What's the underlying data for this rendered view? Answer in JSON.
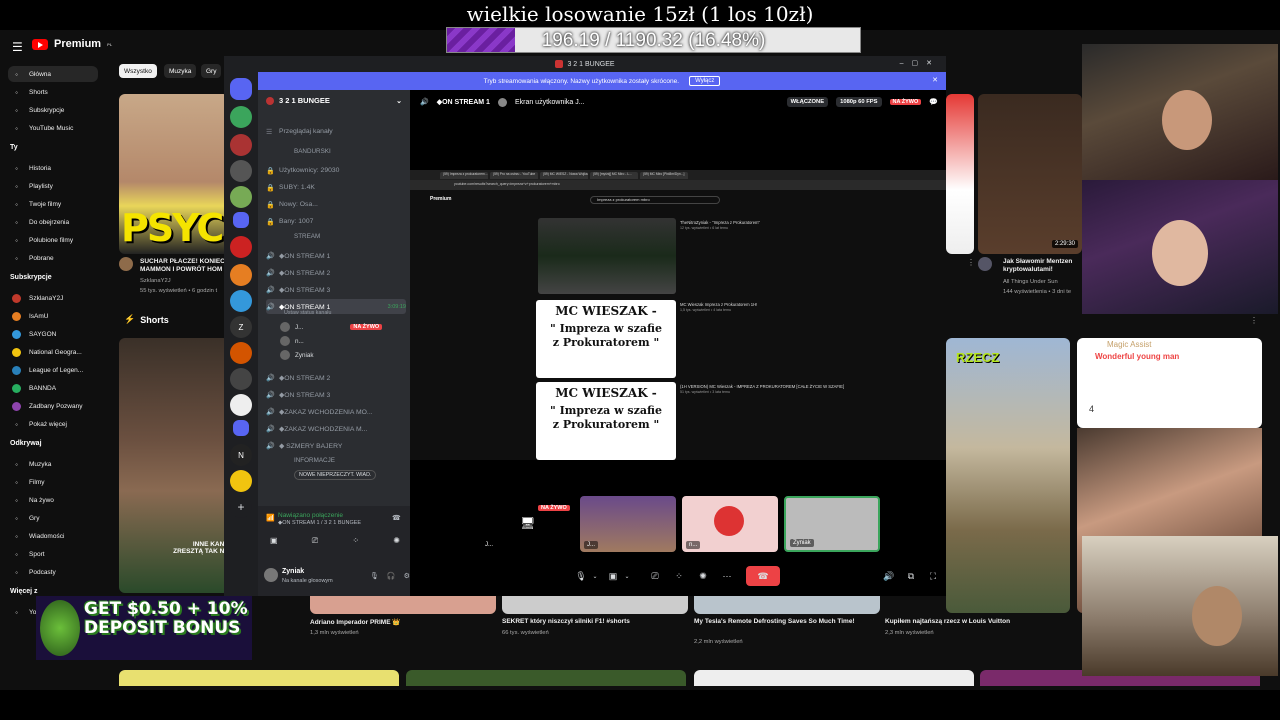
{
  "overlay": {
    "title": "wielkie losowanie 15zł (1 los 10zł)",
    "goal_text": "196.19 / 1190.32 (16.48%)",
    "goal_fraction": 0.1648
  },
  "youtube": {
    "logo": "Premium",
    "logo_sup": "PL",
    "chips": [
      "Wszystko",
      "Muzyka",
      "Gry"
    ],
    "sidebar": {
      "main": [
        {
          "label": "Główna",
          "icon": "home-icon"
        },
        {
          "label": "Shorts",
          "icon": "shorts-icon"
        },
        {
          "label": "Subskrypcje",
          "icon": "subscriptions-icon"
        },
        {
          "label": "YouTube Music",
          "icon": "music-icon"
        }
      ],
      "you_header": "Ty",
      "you": [
        {
          "label": "Historia",
          "icon": "history-icon"
        },
        {
          "label": "Playlisty",
          "icon": "playlist-icon"
        },
        {
          "label": "Twoje filmy",
          "icon": "video-icon"
        },
        {
          "label": "Do obejrzenia",
          "icon": "clock-icon"
        },
        {
          "label": "Polubione filmy",
          "icon": "like-icon"
        },
        {
          "label": "Pobrane",
          "icon": "download-icon"
        }
      ],
      "subs_header": "Subskrypcje",
      "subs": [
        {
          "label": "SzklanaY2J",
          "color": "#c0392b"
        },
        {
          "label": "IsAmU",
          "color": "#e67e22"
        },
        {
          "label": "SAYGON",
          "color": "#3498db"
        },
        {
          "label": "National Geogra...",
          "color": "#f1c40f"
        },
        {
          "label": "League of Legen...",
          "color": "#2980b9"
        },
        {
          "label": "BANNDA",
          "color": "#27ae60"
        },
        {
          "label": "Zadbany Pozwany",
          "color": "#8e44ad"
        }
      ],
      "show_more": "Pokaż więcej",
      "explore_header": "Odkrywaj",
      "explore": [
        {
          "label": "Muzyka",
          "icon": "music-note-icon"
        },
        {
          "label": "Filmy",
          "icon": "film-icon"
        },
        {
          "label": "Na żywo",
          "icon": "live-icon"
        },
        {
          "label": "Gry",
          "icon": "gamepad-icon"
        },
        {
          "label": "Wiadomości",
          "icon": "news-icon"
        },
        {
          "label": "Sport",
          "icon": "trophy-icon"
        },
        {
          "label": "Podcasty",
          "icon": "podcast-icon"
        }
      ],
      "more_header": "Więcej z",
      "more": [
        {
          "label": "YouTube Kids"
        }
      ]
    },
    "videos": [
      {
        "title": "SUCHAR PŁACZE! KONIEC MAMMON I POWRÓT HOM",
        "channel": "SzklanaY2J",
        "meta": "55 tys. wyświetleń • 6 godzin t"
      },
      {
        "title": "Jak Sławomir Mentzen kryptowalutami!",
        "channel": "All Things Under Sun",
        "meta": "144 wyświetlenia • 3 dni te"
      },
      {
        "title": "Adriano Imperador PRIME 👑",
        "meta": "1,3 mln wyświetleń"
      },
      {
        "title": "SEKRET który niszczył silniki F1! #shorts",
        "meta": "66 tys. wyświetleń"
      },
      {
        "title": "My Tesla's Remote Defrosting Saves So Much Time!",
        "meta": "2,2 mln wyświetleń"
      },
      {
        "title": "Kupiłem najtańszą rzecz w Louis Vuitton",
        "meta": "2,3 mln wyświetleń"
      }
    ],
    "shorts_label": "Shorts",
    "thumb_text_psych": "PSYCH",
    "thumb_text_inne": "INNE KANA ZRESZTĄ TAK NA",
    "thumb_duration": "2:29:30",
    "rzecz": "RZECZ",
    "magic": "Magic Assist",
    "wonderful": "Wonderful young man",
    "num4": "4"
  },
  "discord": {
    "window_title": "3 2 1 BUNGEE",
    "banner_text": "Tryb streamowania włączony. Nazwy użytkownika zostały skrócone.",
    "banner_button": "Wyłącz",
    "server_name": "3 2 1 BUNGEE",
    "browse": "Przeglądaj kanały",
    "channels": [
      {
        "label": "BANDURSKI",
        "kind": "category"
      },
      {
        "label": "Użytkownicy: 29030",
        "kind": "stat"
      },
      {
        "label": "SUBY: 1.4K",
        "kind": "stat"
      },
      {
        "label": "Nowy: Osa...",
        "kind": "stat"
      },
      {
        "label": "Bany: 1007",
        "kind": "stat"
      },
      {
        "label": "STREAM",
        "kind": "category"
      },
      {
        "label": "◆ON STREAM 1",
        "kind": "voice"
      },
      {
        "label": "◆ON STREAM 2",
        "kind": "voice"
      },
      {
        "label": "◆ON STREAM 3",
        "kind": "voice"
      },
      {
        "label": "◆ON STREAM 1",
        "kind": "voice-active",
        "time": "3:09:19",
        "status": "Ustaw status kanału"
      },
      {
        "label": "◆ON STREAM 2",
        "kind": "voice"
      },
      {
        "label": "◆ON STREAM 3",
        "kind": "voice"
      },
      {
        "label": "◆ZAKAZ WCHODZENIA MO...",
        "kind": "voice"
      },
      {
        "label": "◆ZAKAZ WCHODZENIA M...",
        "kind": "voice"
      },
      {
        "label": "◆ SZMERY BAJERY",
        "kind": "voice"
      },
      {
        "label": "INFORMACJE",
        "kind": "category"
      }
    ],
    "voice_users": [
      {
        "name": "J...",
        "live": "NA ŻYWO"
      },
      {
        "name": "n..."
      },
      {
        "name": "Zyniak"
      }
    ],
    "new_unread": "NOWE NIEPRZECZYT. WIAD.",
    "connected": "Nawiązano połączenie",
    "connected_sub": "◆ON STREAM 1 / 3 2 1 BUNGEE",
    "user_name": "Zyniak",
    "user_status": "Na kanale głosowym",
    "stage": {
      "channel": "◆ON STREAM 1",
      "screen": "Ekran użytkownika J...",
      "on_badge": "WŁĄCZONE",
      "quality": "1080p 60 FPS",
      "live": "NA ŻYWO"
    },
    "tiles": [
      {
        "name": "J...",
        "live": "NA ŻYWO"
      },
      {
        "name": "J..."
      },
      {
        "name": "n..."
      },
      {
        "name": "Zyniak"
      }
    ]
  },
  "inner_stream": {
    "tabs": [
      "(59) Impreza z prokuratorem...",
      "(59) Pro na ostrzu - YouTube",
      "(59) MC WIESZ - Nowa Wojka...",
      "(59) [myśnij] MC Miro - L...",
      "(59) MC Miro [Pixi8m/Dyn...]"
    ],
    "url": "youtube.com/results?search_query=impreza+z+prokuratorem+mbro",
    "search": "Impreza z prokuratorem mbro",
    "results": [
      {
        "title": "TheNitroZyniak - \"Impreza z Prokuratorem\"",
        "meta": "12 tys. wyświetleń • 6 lat temu"
      },
      {
        "title": "MC Wieszak Impreza z Prokuratorem 1H!",
        "meta": "1,5 tys. wyświetleń • 4 lata temu"
      },
      {
        "title": "(1H VERSION) MC Wieszak - IMPREZA Z PROKURATOREM [CAŁE ŻYCIE W SZAFIE]",
        "meta": "51 tys. wyświetleń • 3 lata temu"
      }
    ],
    "card_title": "MC WIESZAK -",
    "card_sub": "\" Impreza w szafie z Prokuratorem \""
  },
  "ad": {
    "text": "GET $0.50 + 10% DEPOSIT BONUS"
  }
}
